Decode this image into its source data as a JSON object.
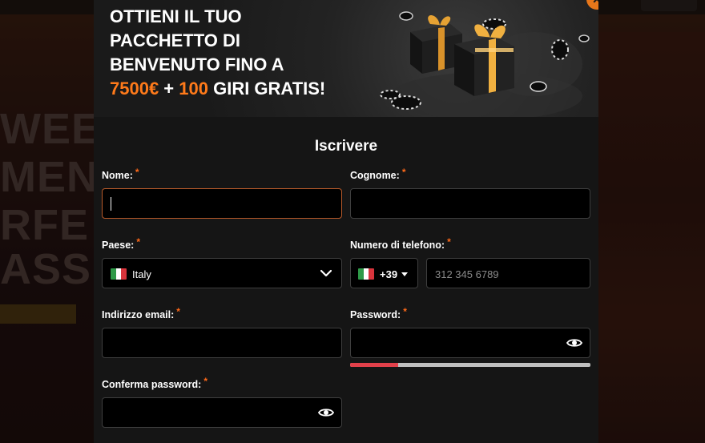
{
  "background": {
    "lines": [
      "WEE",
      "MEN",
      "RFE",
      "ASS"
    ]
  },
  "banner": {
    "line1": "OTTIENI IL TUO",
    "line2": "PACCHETTO DI",
    "line3": "BENVENUTO FINO A",
    "amount": "7500€",
    "plus": " + ",
    "spins": "100",
    "spins_suffix": " GIRI GRATIS!"
  },
  "close_label": "×",
  "title": "Iscrivere",
  "required_mark": "*",
  "form": {
    "first_name": {
      "label": "Nome:",
      "value": ""
    },
    "last_name": {
      "label": "Cognome:",
      "value": ""
    },
    "country": {
      "label": "Paese:",
      "value": "Italy",
      "flag": "italy-flag-icon"
    },
    "phone": {
      "label": "Numero di telefono:",
      "prefix": "+39",
      "placeholder": "312 345 6789"
    },
    "email": {
      "label": "Indirizzo email:",
      "value": ""
    },
    "password": {
      "label": "Password:",
      "value": "",
      "strength_fraction": 0.2
    },
    "confirm_password": {
      "label": "Conferma password:",
      "value": ""
    }
  },
  "colors": {
    "accent": "#ff7a1a",
    "required": "#ff6a1a",
    "strength_weak": "#e2404a"
  }
}
